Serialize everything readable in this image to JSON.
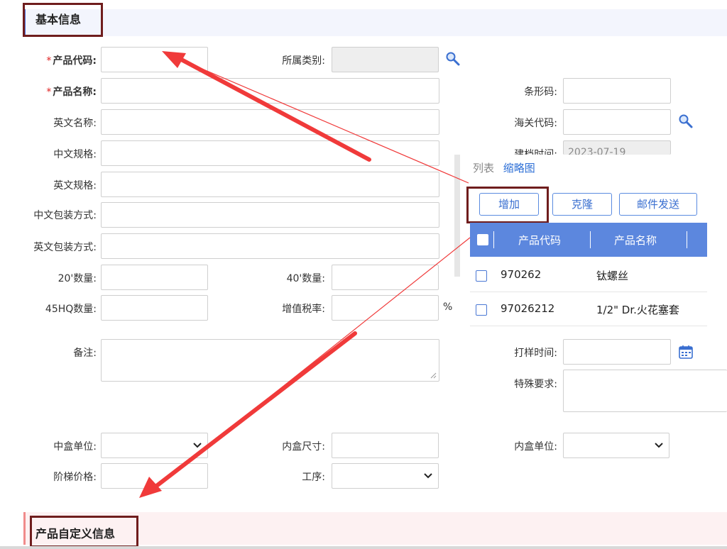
{
  "sections": {
    "basic_info": "基本信息",
    "custom_info": "产品自定义信息"
  },
  "form": {
    "product_code": {
      "label": "产品代码:",
      "required_mark": "*",
      "value": ""
    },
    "category": {
      "label": "所属类别:",
      "value": ""
    },
    "product_name": {
      "label": "产品名称:",
      "required_mark": "*",
      "value": ""
    },
    "barcode": {
      "label": "条形码:",
      "value": ""
    },
    "english_name": {
      "label": "英文名称:",
      "value": ""
    },
    "customs_code": {
      "label": "海关代码:",
      "value": ""
    },
    "cn_spec": {
      "label": "中文规格:",
      "value": ""
    },
    "create_time": {
      "label": "建档时间:",
      "value": "2023-07-19"
    },
    "en_spec": {
      "label": "英文规格:",
      "value": ""
    },
    "cn_packing": {
      "label": "中文包装方式:",
      "value": ""
    },
    "en_packing": {
      "label": "英文包装方式:",
      "value": ""
    },
    "qty20": {
      "label": "20'数量:",
      "value": ""
    },
    "qty40": {
      "label": "40'数量:",
      "value": ""
    },
    "qty45": {
      "label": "45HQ数量:",
      "value": ""
    },
    "vat_rate": {
      "label": "增值税率:",
      "value": "",
      "suffix": "%"
    },
    "remark": {
      "label": "备注:",
      "value": ""
    },
    "sample_time": {
      "label": "打样时间:",
      "value": ""
    },
    "special_req": {
      "label": "特殊要求:",
      "value": ""
    },
    "mid_box_unit": {
      "label": "中盒单位:",
      "value": ""
    },
    "inner_box_size": {
      "label": "内盒尺寸:",
      "value": ""
    },
    "inner_box_unit": {
      "label": "内盒单位:",
      "value": ""
    },
    "tier_price": {
      "label": "阶梯价格:",
      "value": ""
    },
    "process": {
      "label": "工序:",
      "value": ""
    }
  },
  "popup": {
    "tab_list": "列表",
    "tab_thumbnail": "缩略图",
    "buttons": {
      "add": "增加",
      "clone": "克隆",
      "email": "邮件发送"
    },
    "columns": [
      "产品代码",
      "产品名称"
    ],
    "rows": [
      {
        "code": "970262",
        "name": "钛螺丝"
      },
      {
        "code": "97026212",
        "name": "1/2\" Dr.火花塞套"
      }
    ]
  },
  "colors": {
    "accent_blue": "#5c87de",
    "annotation_red": "#f03a3a",
    "highlight_box": "#6f1d1d",
    "required_red": "#e02020"
  },
  "icons": {
    "search": "search-icon",
    "calendar": "calendar-icon",
    "dropdown": "chevron-down-icon"
  }
}
